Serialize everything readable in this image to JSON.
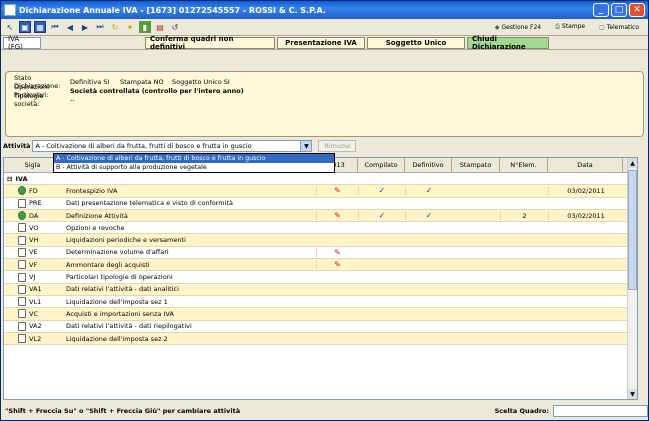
{
  "window": {
    "title": "Dichiarazione Annuale IVA - [1673] 01272545557 - ROSSI & C. S.P.A."
  },
  "toolbar": {
    "buttons": [
      "app-icon",
      "grid-icon",
      "nav-first",
      "nav-prev",
      "nav-next",
      "nav-last",
      "refresh",
      "wizard",
      "chart",
      "book",
      "undo"
    ],
    "right": [
      {
        "name": "gestione-f24",
        "label": "Gestione F24"
      },
      {
        "name": "stampe",
        "label": "Stampe"
      },
      {
        "name": "telematico",
        "label": "Telematico"
      }
    ]
  },
  "tabs": {
    "current": "IVA (FG)",
    "conferma": "Conferma quadri non definitivi",
    "presentazione": "Presentazione IVA",
    "soggetto": "Soggetto Unico",
    "chiudi": "Chiudi Dichiarazione"
  },
  "info": {
    "stato_label": "Stato Dichiarazione:",
    "stato_def": "Definitiva  SI",
    "stato_stamp": "Stampata  NO",
    "stato_sogg": "Soggetto Unico  SI",
    "oper_label": "Operazioni Particolari:",
    "oper_value": "Società controllata (controllo per l'intero anno)",
    "tip_label": "Tipologia società:",
    "tip_value": "--"
  },
  "attivita": {
    "label": "Attività",
    "selected": "A - Coltivazione di alberi da frutta, frutti di bosco e frutta in guscio",
    "ghost_button": "Rimuovi",
    "options": [
      "A - Coltivazione di alberi da frutta, frutti di bosco e frutta in guscio",
      "B - Attività di supporto alla produzione vegetale"
    ]
  },
  "grid": {
    "headers": {
      "sigla": "Sigla",
      "y2013": "2013",
      "compilato": "Compilato",
      "definitivo": "Definitivo",
      "stampato": "Stampato",
      "nelem": "N°Elem.",
      "data": "Data"
    },
    "group": "IVA",
    "rows": [
      {
        "sigla": "FD",
        "desc": "Frontespizio IVA",
        "ok": true,
        "pencil": true,
        "comp": true,
        "def": true,
        "nelem": "",
        "data": "03/02/2011"
      },
      {
        "sigla": "PRE",
        "desc": "Dati presentazione telematica e visto di conformità",
        "ok": false,
        "pencil": false,
        "comp": false,
        "def": false,
        "nelem": "",
        "data": ""
      },
      {
        "sigla": "DA",
        "desc": "Definizione Attività",
        "ok": true,
        "pencil": true,
        "comp": true,
        "def": true,
        "nelem": "2",
        "data": "03/02/2011"
      },
      {
        "sigla": "VO",
        "desc": "Opzioni e revoche",
        "ok": false,
        "pencil": false,
        "comp": false,
        "def": false,
        "nelem": "",
        "data": ""
      },
      {
        "sigla": "VH",
        "desc": "Liquidazioni periodiche e versamenti",
        "ok": false,
        "pencil": false,
        "comp": false,
        "def": false,
        "nelem": "",
        "data": ""
      },
      {
        "sigla": "VE",
        "desc": "Determinazione volume d'affari",
        "ok": false,
        "pencil": true,
        "comp": false,
        "def": false,
        "nelem": "",
        "data": ""
      },
      {
        "sigla": "VF",
        "desc": "Ammontare degli acquisti",
        "ok": false,
        "pencil": true,
        "comp": false,
        "def": false,
        "nelem": "",
        "data": ""
      },
      {
        "sigla": "VJ",
        "desc": "Particolari tipologie di operazioni",
        "ok": false,
        "pencil": false,
        "comp": false,
        "def": false,
        "nelem": "",
        "data": ""
      },
      {
        "sigla": "VA1",
        "desc": "Dati relativi l'attività - dati analitici",
        "ok": false,
        "pencil": false,
        "comp": false,
        "def": false,
        "nelem": "",
        "data": ""
      },
      {
        "sigla": "VL1",
        "desc": "Liquidazione dell'imposta sez 1",
        "ok": false,
        "pencil": false,
        "comp": false,
        "def": false,
        "nelem": "",
        "data": ""
      },
      {
        "sigla": "VC",
        "desc": "Acquisti e importazioni senza IVA",
        "ok": false,
        "pencil": false,
        "comp": false,
        "def": false,
        "nelem": "",
        "data": ""
      },
      {
        "sigla": "VA2",
        "desc": "Dati relativi l'attività - dati riepilogativi",
        "ok": false,
        "pencil": false,
        "comp": false,
        "def": false,
        "nelem": "",
        "data": ""
      },
      {
        "sigla": "VL2",
        "desc": "Liquidazione dell'imposta sez 2",
        "ok": false,
        "pencil": false,
        "comp": false,
        "def": false,
        "nelem": "",
        "data": ""
      }
    ]
  },
  "status": {
    "hint": "\"Shift + Freccia Su\" o \"Shift + Freccia Giù\" per cambiare attività",
    "quadro_label": "Scelta Quadro:"
  }
}
